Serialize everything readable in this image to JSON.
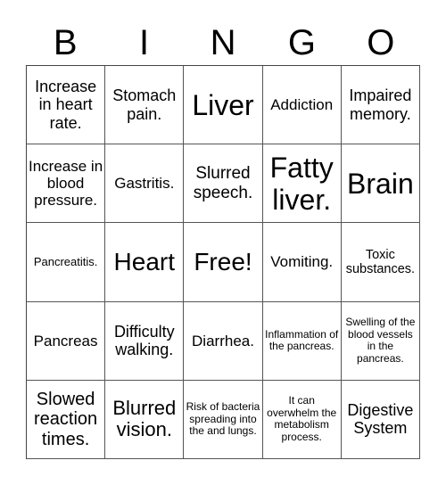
{
  "header": {
    "letters": [
      "B",
      "I",
      "N",
      "G",
      "O"
    ]
  },
  "cells": [
    [
      "Increase in heart rate.",
      "Stomach pain.",
      "Liver",
      "Addiction",
      "Impaired memory."
    ],
    [
      "Increase in blood pressure.",
      "Gastritis.",
      "Slurred speech.",
      "Fatty liver.",
      "Brain"
    ],
    [
      "Pancreatitis.",
      "Heart",
      "Free!",
      "Vomiting.",
      "Toxic substances."
    ],
    [
      "Pancreas",
      "Difficulty walking.",
      "Diarrhea.",
      "Inflammation of the pancreas.",
      "Swelling of the blood vessels in the pancreas."
    ],
    [
      "Slowed reaction times.",
      "Blurred vision.",
      "Risk of bacteria spreading into the and lungs.",
      "It can overwhelm the metabolism process.",
      "Digestive System"
    ]
  ]
}
